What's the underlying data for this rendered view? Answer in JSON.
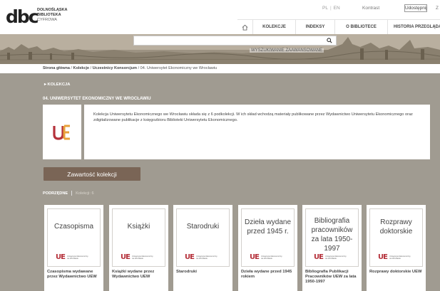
{
  "logo": {
    "mark": "dbc",
    "line1": "DOLNOŚLĄSKA",
    "line2": "BIBLIOTEKA",
    "line3": "CYFROWA"
  },
  "top_links": {
    "lang_pl": "PL",
    "lang_sep": "|",
    "lang_en": "EN",
    "contrast": "Kontrast",
    "font_bigger": "Udostępnij",
    "z": "Z"
  },
  "nav": {
    "items": [
      "KOLEKCJE",
      "INDEKSY",
      "O BIBLIOTECE",
      "HISTORIA PRZEGLĄDANIA"
    ]
  },
  "search": {
    "placeholder": "",
    "advanced": "WYSZUKIWANIE ZAAWANSOWANE"
  },
  "breadcrumb": {
    "home": "Strona główna",
    "collections": "Kolekcje",
    "consortium": "Uczestnicy Konsorcjum",
    "current": "04. Uniwersytet Ekonomiczny we Wrocławiu"
  },
  "collection": {
    "toggle_label": "KOLEKCJA",
    "title": "04. UNIWERSYTET EKONOMICZNY WE WROCŁAWIU",
    "description": "Kolekcja Uniwersytetu Ekonomicznego we Wrocławiu składa się z 6 podkolekcji. W ich skład wchodzą materiały publikowane przez Wydawnictwo Uniwersytetu Ekonomicznego oraz zdigitalizowane publikacje z księgozbioru Biblioteki Uniwersytetu Ekonomicznego.",
    "contents_button": "Zawartość kolekcji"
  },
  "subs": {
    "active_tab": "PODRZĘDNE",
    "inactive_tab": "Kolekcji: 6"
  },
  "cards": [
    {
      "title": "Czasopisma",
      "caption": "Czasopisma wydawane przez Wydawnictwo UEW"
    },
    {
      "title": "Książki",
      "caption": "Książki wydane przez Wydawnictwo UEW"
    },
    {
      "title": "Starodruki",
      "caption": "Starodruki"
    },
    {
      "title": "Dzieła wydane przed 1945 r.",
      "caption": "Dzieła wydane przed 1945 rokiem"
    },
    {
      "title": "Bibliografia pracowników za lata 1950-1997",
      "caption": "Bibliografia Publikacji Pracowników UEW za lata 1950-1997"
    },
    {
      "title": "Rozprawy doktorskie",
      "caption": "Rozprawy doktorskie UEW"
    }
  ],
  "mini_logo": {
    "ue": "UE",
    "text1": "Uniwersytet Ekonomiczny",
    "text2": "we Wrocławiu"
  },
  "colors": {
    "page_bg": "#a09b91",
    "button_bg": "#7a6556",
    "ue_red": "#b5313b"
  }
}
